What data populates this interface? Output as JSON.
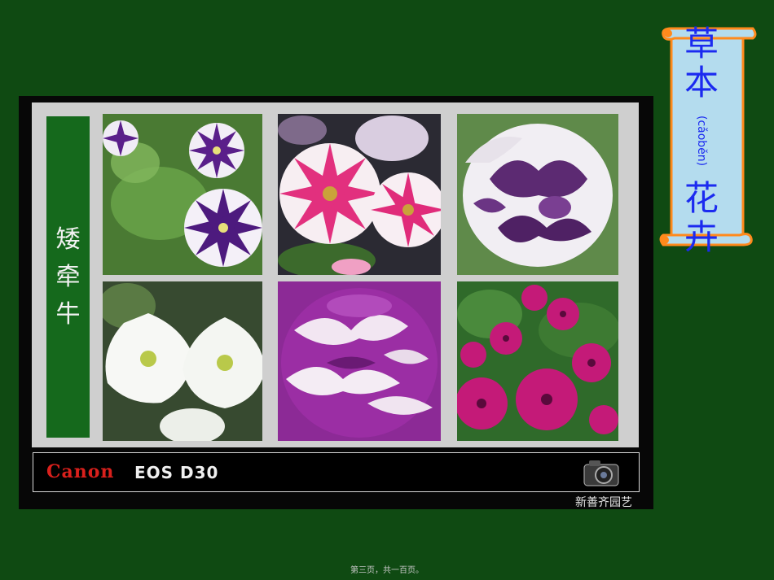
{
  "side_label": [
    "矮",
    "牵",
    "牛"
  ],
  "photos": [
    {
      "name": "purple-white-star-petunia"
    },
    {
      "name": "pink-white-star-petunia"
    },
    {
      "name": "ruffled-white-purple-petunia"
    },
    {
      "name": "white-petunia"
    },
    {
      "name": "ruffled-purple-petunia"
    },
    {
      "name": "magenta-petunia-bush"
    }
  ],
  "caption_bar": {
    "brand": "Canon",
    "model": "EOS D30"
  },
  "studio": "新善齐园艺",
  "scroll": {
    "char1": "草",
    "char2": "本",
    "pinyin": "(cǎoběn)",
    "char3": "花",
    "char4": "卉"
  },
  "footer": "第三页，共一百页。",
  "colors": {
    "background": "#0f4a12",
    "side_label": "#15691c",
    "scroll_text": "#1b2af0",
    "scroll_fill": "#b4dcee",
    "scroll_border": "#ff8a1c"
  }
}
